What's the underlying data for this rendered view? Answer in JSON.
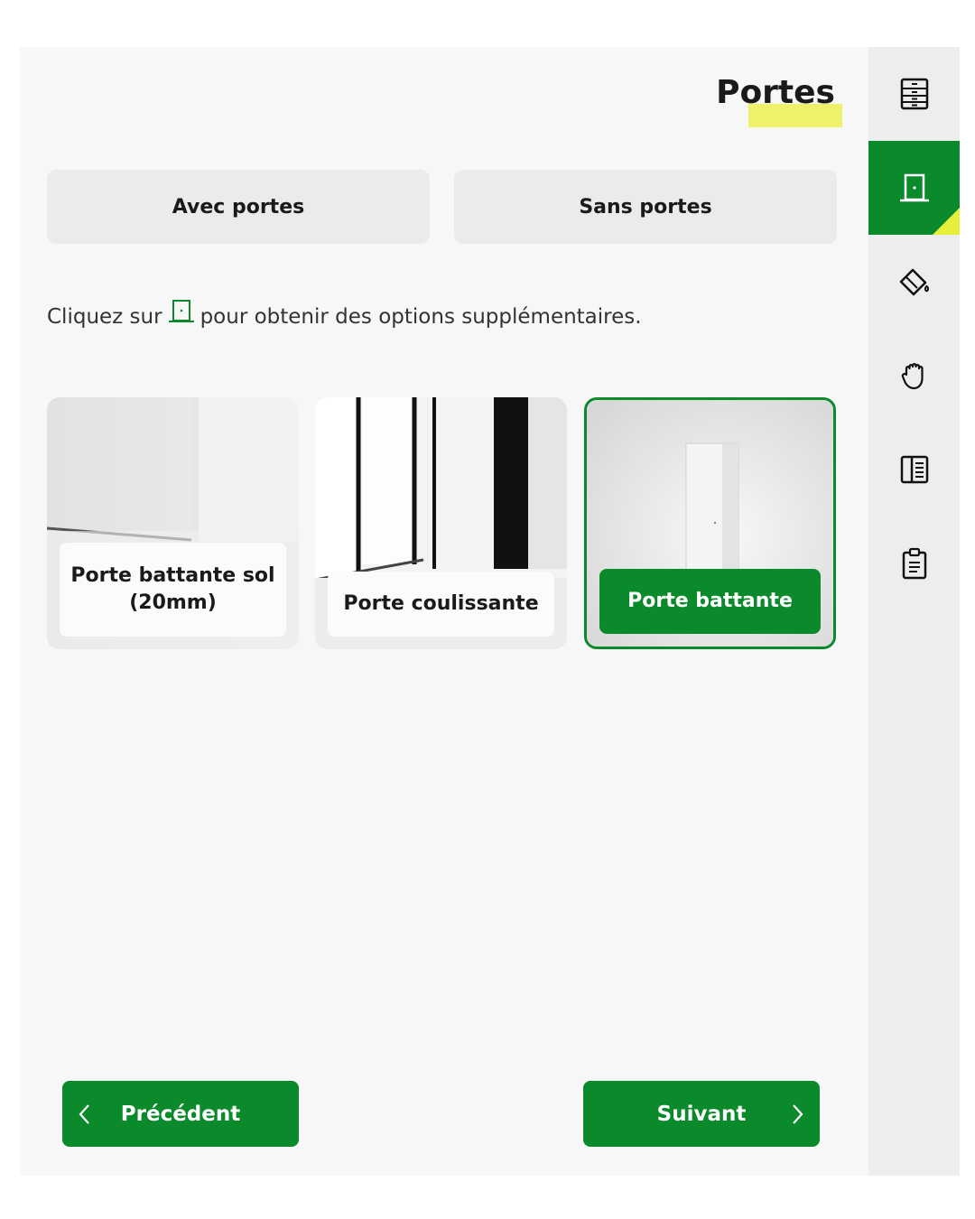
{
  "header": {
    "title": "Portes"
  },
  "door_choice": {
    "with_label": "Avec portes",
    "without_label": "Sans portes"
  },
  "hint": {
    "before": "Cliquez sur",
    "after": "pour obtenir des options supplémentaires."
  },
  "options": [
    {
      "label": "Porte battante sol (20mm)",
      "selected": false
    },
    {
      "label": "Porte coulissante",
      "selected": false
    },
    {
      "label": "Porte battante",
      "selected": true
    }
  ],
  "footer": {
    "prev_label": "Précédent",
    "next_label": "Suivant"
  },
  "sidebar": {
    "items": [
      {
        "icon": "cabinet-icon",
        "active": false
      },
      {
        "icon": "door-icon",
        "active": true
      },
      {
        "icon": "paint-bucket-icon",
        "active": false
      },
      {
        "icon": "hand-icon",
        "active": false
      },
      {
        "icon": "panel-icon",
        "active": false
      },
      {
        "icon": "clipboard-icon",
        "active": false
      }
    ]
  },
  "colors": {
    "accent": "#0a8a2a",
    "highlight": "#e6f03c",
    "background": "#f7f7f7"
  }
}
